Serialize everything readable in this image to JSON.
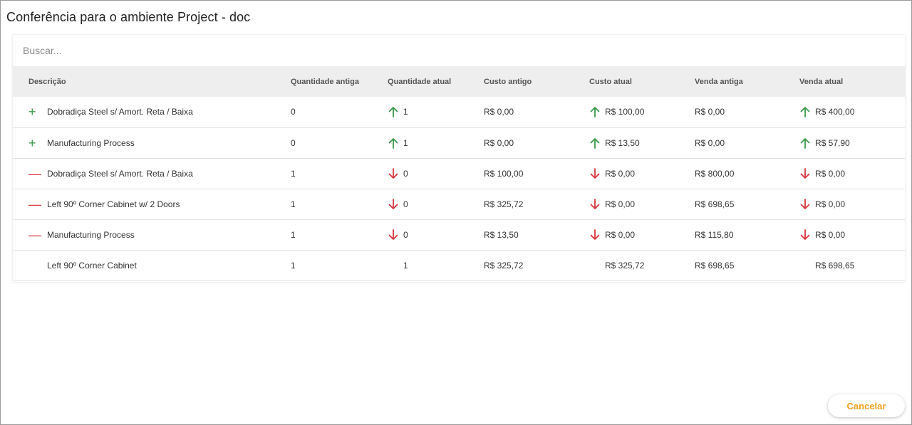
{
  "dialog": {
    "title": "Conferência para o ambiente Project - doc",
    "search_placeholder": "Buscar...",
    "cancel_label": "Cancelar"
  },
  "colors": {
    "up": "#3a9a4a",
    "down": "#d9363e",
    "accent": "#f0a020"
  },
  "table": {
    "headers": [
      "Descrição",
      "Quantidade antiga",
      "Quantidade atual",
      "Custo antigo",
      "Custo atual",
      "Venda antiga",
      "Venda atual"
    ],
    "rows": [
      {
        "status": "added",
        "status_icon": "plus-icon",
        "desc": "Dobradiça Steel s/ Amort. Reta / Baixa",
        "qty_old": "0",
        "qty_new": "1",
        "qty_trend": "up",
        "cost_old": "R$ 0,00",
        "cost_new": "R$ 100,00",
        "cost_trend": "up",
        "sale_old": "R$ 0,00",
        "sale_new": "R$ 400,00",
        "sale_trend": "up"
      },
      {
        "status": "added",
        "status_icon": "plus-icon",
        "desc": "Manufacturing Process",
        "qty_old": "0",
        "qty_new": "1",
        "qty_trend": "up",
        "cost_old": "R$ 0,00",
        "cost_new": "R$ 13,50",
        "cost_trend": "up",
        "sale_old": "R$ 0,00",
        "sale_new": "R$ 57,90",
        "sale_trend": "up"
      },
      {
        "status": "removed",
        "status_icon": "minus-icon",
        "desc": "Dobradiça Steel s/ Amort. Reta / Baixa",
        "qty_old": "1",
        "qty_new": "0",
        "qty_trend": "down",
        "cost_old": "R$ 100,00",
        "cost_new": "R$ 0,00",
        "cost_trend": "down",
        "sale_old": "R$ 800,00",
        "sale_new": "R$ 0,00",
        "sale_trend": "down"
      },
      {
        "status": "removed",
        "status_icon": "minus-icon",
        "desc": "Left 90º Corner Cabinet w/ 2 Doors",
        "qty_old": "1",
        "qty_new": "0",
        "qty_trend": "down",
        "cost_old": "R$ 325,72",
        "cost_new": "R$ 0,00",
        "cost_trend": "down",
        "sale_old": "R$ 698,65",
        "sale_new": "R$ 0,00",
        "sale_trend": "down"
      },
      {
        "status": "removed",
        "status_icon": "minus-icon",
        "desc": "Manufacturing Process",
        "qty_old": "1",
        "qty_new": "0",
        "qty_trend": "down",
        "cost_old": "R$ 13,50",
        "cost_new": "R$ 0,00",
        "cost_trend": "down",
        "sale_old": "R$ 115,80",
        "sale_new": "R$ 0,00",
        "sale_trend": "down"
      },
      {
        "status": "unchanged",
        "status_icon": "",
        "desc": "Left 90º Corner Cabinet",
        "qty_old": "1",
        "qty_new": "1",
        "qty_trend": "none",
        "cost_old": "R$ 325,72",
        "cost_new": "R$ 325,72",
        "cost_trend": "none",
        "sale_old": "R$ 698,65",
        "sale_new": "R$ 698,65",
        "sale_trend": "none"
      }
    ]
  }
}
